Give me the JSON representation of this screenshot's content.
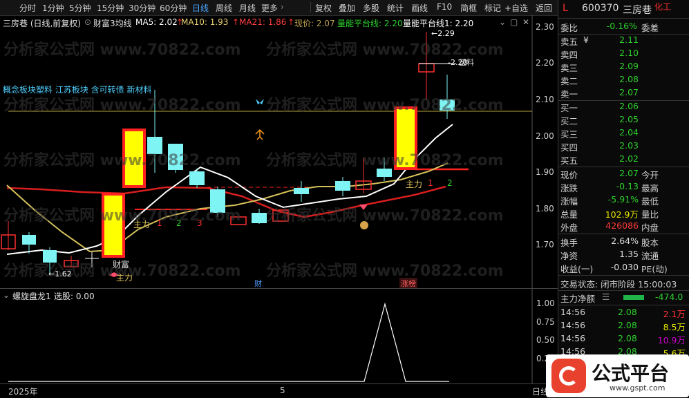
{
  "tabs": [
    "分时",
    "1分钟",
    "5分钟",
    "15分钟",
    "30分钟",
    "60分钟",
    "日线",
    "周线",
    "月线",
    "更多"
  ],
  "active_tab": "日线",
  "tools": [
    "复权",
    "叠加",
    "多股",
    "统计",
    "画线",
    "F10",
    "简框",
    "标记",
    "+自选",
    "返回"
  ],
  "chart_title": "三房巷 (日线,前复权)",
  "indicator_name": "财富3均线",
  "ma5": "MA5: 2.02",
  "ma10": "MA10: 1.93",
  "ma21": "MA21: 1.86",
  "current_price_label": "现价: 2.07",
  "volume_platform": "量能平台线: 2.20",
  "volume_platform1": "量能平台线1: 2.20",
  "concepts": "概念板块塑料  江苏板块  含可转债  新材料",
  "watermark": "分析家公式网 www.70822.com",
  "y_axis": [
    "2.30",
    "2.20",
    "2.10",
    "2.00",
    "1.90",
    "1.80",
    "1.70"
  ],
  "sub_y_axis": [
    "1.00",
    "0.75",
    "0.50",
    "0.25"
  ],
  "sub_title": "螺旋盘龙1",
  "sub_value": "选股: 0.00",
  "annotations": {
    "high": "2.29",
    "low": "1.62",
    "platform": "2.20",
    "plastic": "塑料",
    "caifu": "财富",
    "zhuli_left": "主力",
    "zhuli_mid": "主力",
    "zhuli_right": "主力",
    "n1": "1",
    "n2": "2",
    "n3": "3",
    "r1": "1",
    "r2": "2",
    "cai_tag": "财",
    "zhangbang_tag": "涨榜",
    "jian": "减仓"
  },
  "x_axis": {
    "year": "2025年",
    "month": "5",
    "right": "日线"
  },
  "stock": {
    "code": "600370",
    "name": "三房巷",
    "tag": "化工",
    "letter": "L"
  },
  "weibi": {
    "label": "委比",
    "value": "-0.16%",
    "right": "委差"
  },
  "asks": [
    {
      "label": "卖五",
      "price": "2.11",
      "flag": "¥"
    },
    {
      "label": "卖四",
      "price": "2.10"
    },
    {
      "label": "卖三",
      "price": "2.09"
    },
    {
      "label": "卖二",
      "price": "2.08"
    },
    {
      "label": "卖一",
      "price": "2.07"
    }
  ],
  "bids": [
    {
      "label": "买一",
      "price": "2.06"
    },
    {
      "label": "买二",
      "price": "2.05"
    },
    {
      "label": "买三",
      "price": "2.04"
    },
    {
      "label": "买四",
      "price": "2.03"
    },
    {
      "label": "买五",
      "price": "2.02"
    }
  ],
  "quote": [
    {
      "l": "现价",
      "v": "2.07",
      "r": "今开",
      "cls": "dn"
    },
    {
      "l": "涨跌",
      "v": "-0.13",
      "r": "最高",
      "cls": "dn"
    },
    {
      "l": "涨幅",
      "v": "-5.91%",
      "r": "最低",
      "cls": "dn"
    },
    {
      "l": "总量",
      "v": "102.9万",
      "r": "量比",
      "cls": "yl"
    },
    {
      "l": "外盘",
      "v": "426086",
      "r": "内盘",
      "cls": "up"
    }
  ],
  "quote2": [
    {
      "l": "换手",
      "v": "2.64%",
      "r": "股本"
    },
    {
      "l": "净资",
      "v": "1.35",
      "r": "流通"
    },
    {
      "l": "收益(一)",
      "v": "-0.030",
      "r": "PE(动)"
    }
  ],
  "trade_status": "交易状态: 闭市阶段 15:00:03",
  "main_net": {
    "label": "主力净额",
    "value": "-474.0"
  },
  "ticks": [
    {
      "t": "14:56",
      "p": "2.08",
      "v": "2.1万",
      "c": "up"
    },
    {
      "t": "14:56",
      "p": "2.08",
      "v": "8.5万",
      "c": "yl"
    },
    {
      "t": "14:56",
      "p": "2.08",
      "v": "10.9万",
      "c": "mg"
    },
    {
      "t": "14:56",
      "p": "2.08",
      "v": "5.6万",
      "c": "yl"
    }
  ],
  "logo": {
    "text": "公式平台",
    "url": "www.gspt.com"
  }
}
